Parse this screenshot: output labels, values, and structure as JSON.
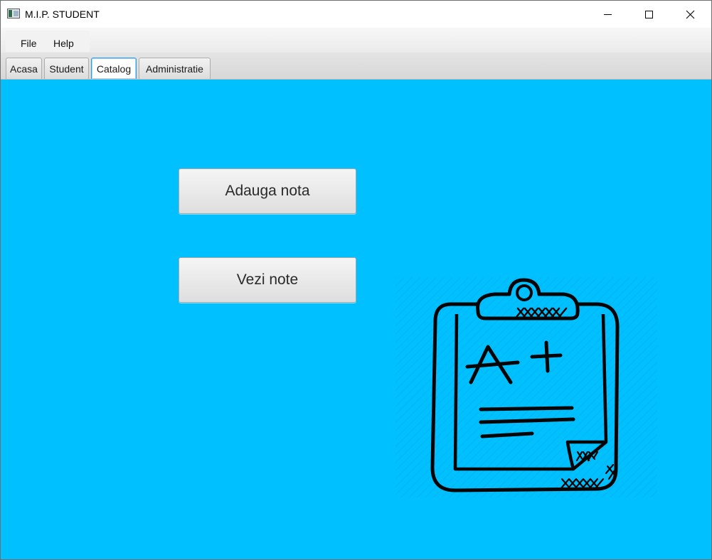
{
  "window": {
    "title": "M.I.P. STUDENT"
  },
  "menubar": {
    "items": [
      {
        "label": "File"
      },
      {
        "label": "Help"
      }
    ]
  },
  "tabs": [
    {
      "label": "Acasa"
    },
    {
      "label": "Student"
    },
    {
      "label": "Catalog",
      "selected": true
    },
    {
      "label": "Administratie"
    }
  ],
  "main": {
    "background_color": "#00c0ff",
    "add_grade_label": "Adauga nota",
    "view_grades_label": "Vezi note",
    "illustration": {
      "icon": "clipboard-grade-icon",
      "grade_text": "A+"
    }
  }
}
